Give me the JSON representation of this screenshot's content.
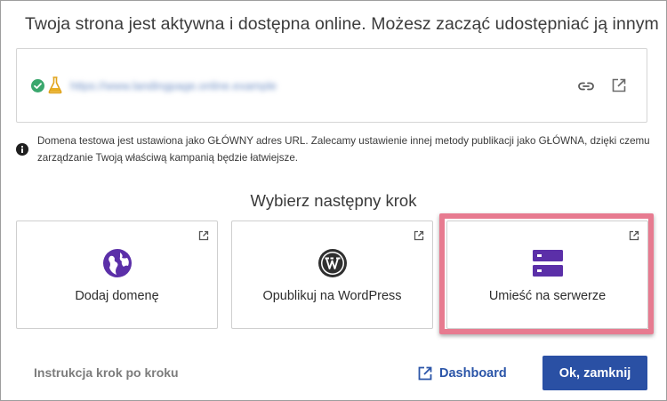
{
  "dialog": {
    "headline": "Twoja strona jest aktywna i dostępna online. Możesz zacząć udostępniać ją innym",
    "url": "https://www.landingpage.online.example",
    "info_text": "Domena testowa jest ustawiona jako GŁÓWNY adres URL. Zalecamy ustawienie innej metody publikacji jako GŁÓWNA, dzięki czemu zarządzanie Twoją właściwą kampanią będzie łatwiejsze.",
    "next_step_title": "Wybierz następny krok",
    "cards": [
      {
        "label": "Dodaj domenę",
        "icon": "globe-icon",
        "color": "#5b2fa8"
      },
      {
        "label": "Opublikuj na WordPress",
        "icon": "wordpress-icon",
        "color": "#2f2f2f"
      },
      {
        "label": "Umieść na serwerze",
        "icon": "server-icon",
        "color": "#5b2fa8",
        "highlighted": true
      }
    ],
    "footer": {
      "guide_link": "Instrukcja krok po kroku",
      "dashboard": "Dashboard",
      "ok_button": "Ok, zamknij"
    }
  },
  "colors": {
    "primary": "#2a50a4",
    "accent_purple": "#5b2fa8",
    "success_green": "#3aa76d",
    "highlight_pink": "#e77b90"
  }
}
